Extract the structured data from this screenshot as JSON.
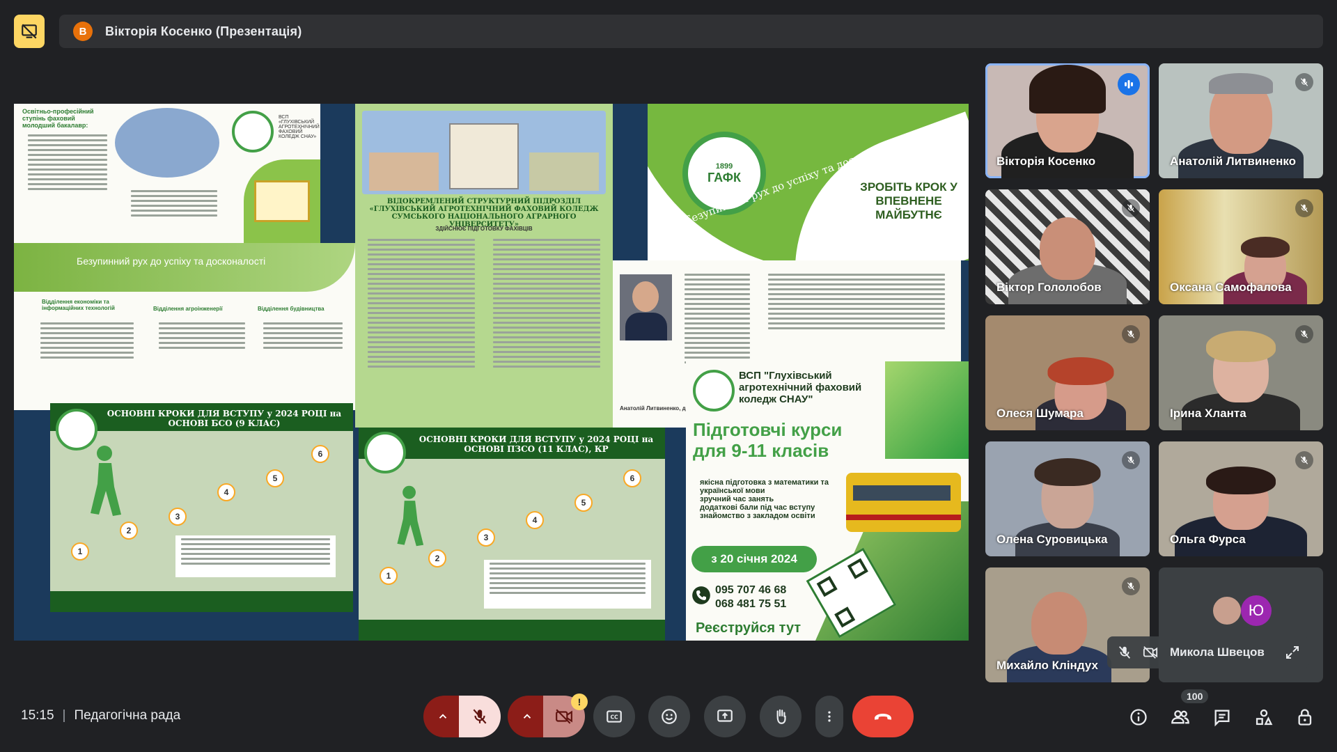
{
  "presenter": {
    "avatar_letter": "В",
    "title": "Вікторія Косенко (Презентація)"
  },
  "slide": {
    "left_top_header": "Освітньо-професійний ступінь фаховий молодший бакалавр:",
    "college_short": "ВСП «ГЛУХІВСЬКИЙ АГРОТЕХНІЧНИЙ ФАХОВИЙ КОЛЕДЖ СНАУ»",
    "motto": "Безупинний рух до успіху та досконалості",
    "motto_curved": "Безупинний рух до успіху та досконалості",
    "dept1": "Відділення економіки та інформаційних технологій",
    "dept2": "Відділення агроінженерії",
    "dept3": "Відділення будівництва",
    "center_title": "ВІДОКРЕМЛЕНИЙ СТРУКТУРНИЙ ПІДРОЗДІЛ «ГЛУХІВСЬКИЙ АГРОТЕХНІЧНИЙ ФАХОВИЙ КОЛЕДЖ СУМСЬКОГО НАЦІОНАЛЬНОГО АГРАРНОГО УНІВЕРСИТЕТУ»",
    "center_sub": "ЗДІЙСНЮЄ ПІДГОТОВКУ ФАХІВЦІВ",
    "right_slogan": "ЗРОБІТЬ КРОК У ВПЕВНЕНЕ МАЙБУТНЄ",
    "steps_title_1": "ОСНОВНІ КРОКИ ДЛЯ ВСТУПУ у 2024 РОЦІ на ОСНОВІ БСО (9 КЛАС)",
    "steps_title_2": "ОСНОВНІ КРОКИ ДЛЯ ВСТУПУ у 2024 РОЦІ на ОСНОВІ ПЗСО (11 КЛАС), КР",
    "director_name": "Анатолій Литвиненко, директор",
    "courses_college": "ВСП \"Глухівський агротехнічний фаховий коледж СНАУ\"",
    "courses_title": "Підготовчі курси для 9-11 класів",
    "courses_items": [
      "якісна підготовка з математики та української мови",
      "зручний час занять",
      "додаткові бали під час вступу",
      "знайомство з закладом освіти"
    ],
    "courses_date": "з 20 січня 2024",
    "phone1": "095 707 46 68",
    "phone2": "068 481 75 51",
    "register": "Реєструйся тут",
    "emblem_text": "ГАФК",
    "emblem_year": "1899"
  },
  "participants": [
    {
      "name": "Вікторія Косенко",
      "speaking": true
    },
    {
      "name": "Анатолій Литвиненко",
      "speaking": false
    },
    {
      "name": "Віктор Гололобов",
      "speaking": false
    },
    {
      "name": "Оксана Самофалова",
      "speaking": false
    },
    {
      "name": "Олеся Шумара",
      "speaking": false
    },
    {
      "name": "Ірина Хланта",
      "speaking": false
    },
    {
      "name": "Олена Суровицька",
      "speaking": false
    },
    {
      "name": "Ольга Фурса",
      "speaking": false
    },
    {
      "name": "Михайло Кліндух",
      "speaking": false
    }
  ],
  "others_tile": {
    "name": "Микола Швецов",
    "avatar_letter": "Ю"
  },
  "bottom": {
    "time": "15:15",
    "meeting": "Педагогічна рада",
    "participants_count": "100",
    "camera_warning": "!"
  },
  "colors": {
    "bg": "#202124",
    "accent_blue": "#1a73e8",
    "end_call": "#ea4335",
    "present_yellow": "#fdd663",
    "brand_green": "#43a047"
  }
}
